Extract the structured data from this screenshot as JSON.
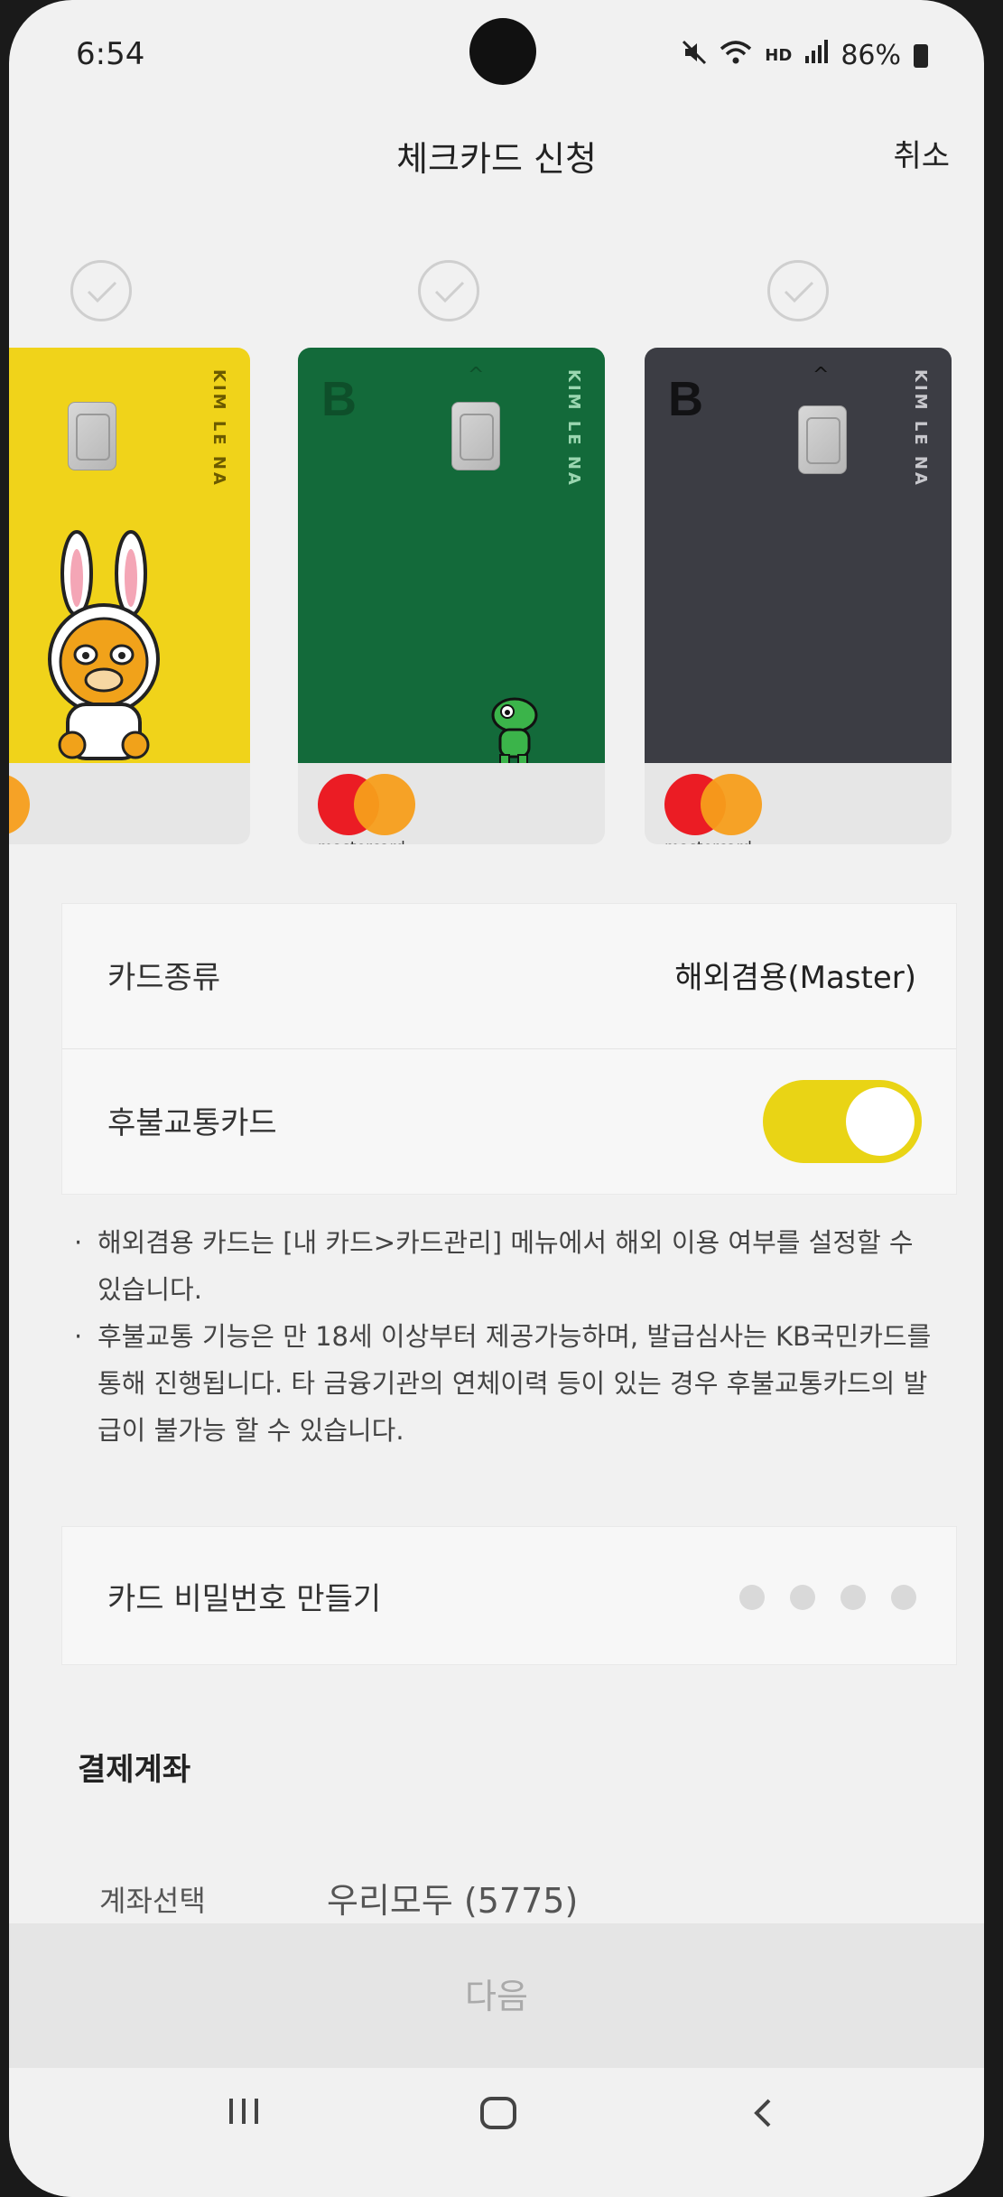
{
  "status": {
    "time": "6:54",
    "hd": "HD",
    "battery": "86%"
  },
  "header": {
    "title": "체크카드 신청",
    "cancel": "취소"
  },
  "cards": [
    {
      "name": "KIM LE NA",
      "brand_text": "card",
      "color": "#f0d31a"
    },
    {
      "name": "KIM LE NA",
      "brand_text": "mastercard",
      "color": "#136a3a"
    },
    {
      "name": "KIM LE NA",
      "brand_text": "mastercard",
      "color": "#3c3d44"
    }
  ],
  "settings": {
    "card_type_label": "카드종류",
    "card_type_value": "해외겸용(Master)",
    "transit_label": "후불교통카드",
    "transit_on": true
  },
  "notes": [
    "해외겸용 카드는 [내 카드>카드관리] 메뉴에서 해외 이용 여부를 설정할 수 있습니다.",
    "후불교통 기능은 만 18세 이상부터 제공가능하며, 발급심사는 KB국민카드를 통해 진행됩니다. 타 금융기관의 연체이력 등이 있는 경우 후불교통카드의 발급이 불가능 할 수 있습니다."
  ],
  "pin": {
    "label": "카드 비밀번호 만들기"
  },
  "account": {
    "section_title": "결제계좌",
    "label": "계좌선택",
    "value": "우리모두 (5775)"
  },
  "next_button": "다음",
  "colors": {
    "accent_yellow": "#e9d415",
    "card_green": "#136a3a",
    "card_dark": "#3c3d44"
  }
}
